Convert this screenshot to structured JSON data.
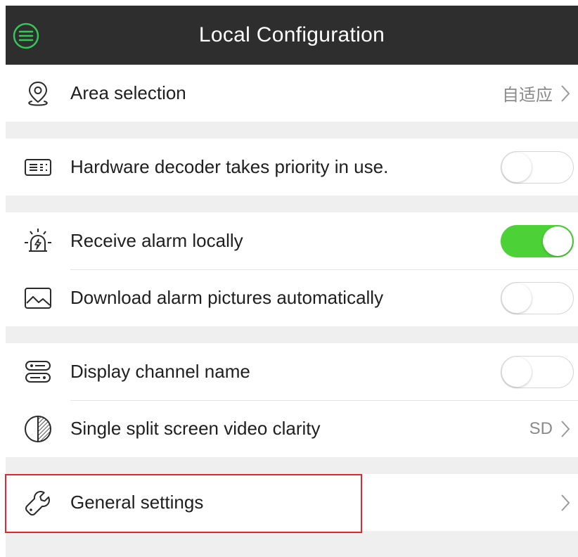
{
  "header": {
    "title": "Local Configuration",
    "menu_icon": "menu-circle-icon",
    "accent_color": "#34c759"
  },
  "rows": {
    "area_selection": {
      "label": "Area selection",
      "value": "自适应",
      "icon": "location-pin-icon"
    },
    "hardware_decoder": {
      "label": "Hardware decoder takes priority in use.",
      "toggle": false,
      "icon": "decoder-card-icon"
    },
    "receive_alarm": {
      "label": "Receive alarm locally",
      "toggle": true,
      "icon": "alarm-siren-icon"
    },
    "download_pictures": {
      "label": "Download alarm pictures automatically",
      "toggle": false,
      "icon": "picture-icon"
    },
    "display_channel": {
      "label": "Display channel name",
      "toggle": false,
      "icon": "channel-name-icon"
    },
    "video_clarity": {
      "label": "Single split screen video clarity",
      "value": "SD",
      "icon": "half-circle-icon"
    },
    "general_settings": {
      "label": "General settings",
      "icon": "wrench-icon"
    }
  },
  "colors": {
    "header_bg": "#2e2e2e",
    "toggle_on": "#4cd137",
    "highlight": "#e0282e"
  }
}
